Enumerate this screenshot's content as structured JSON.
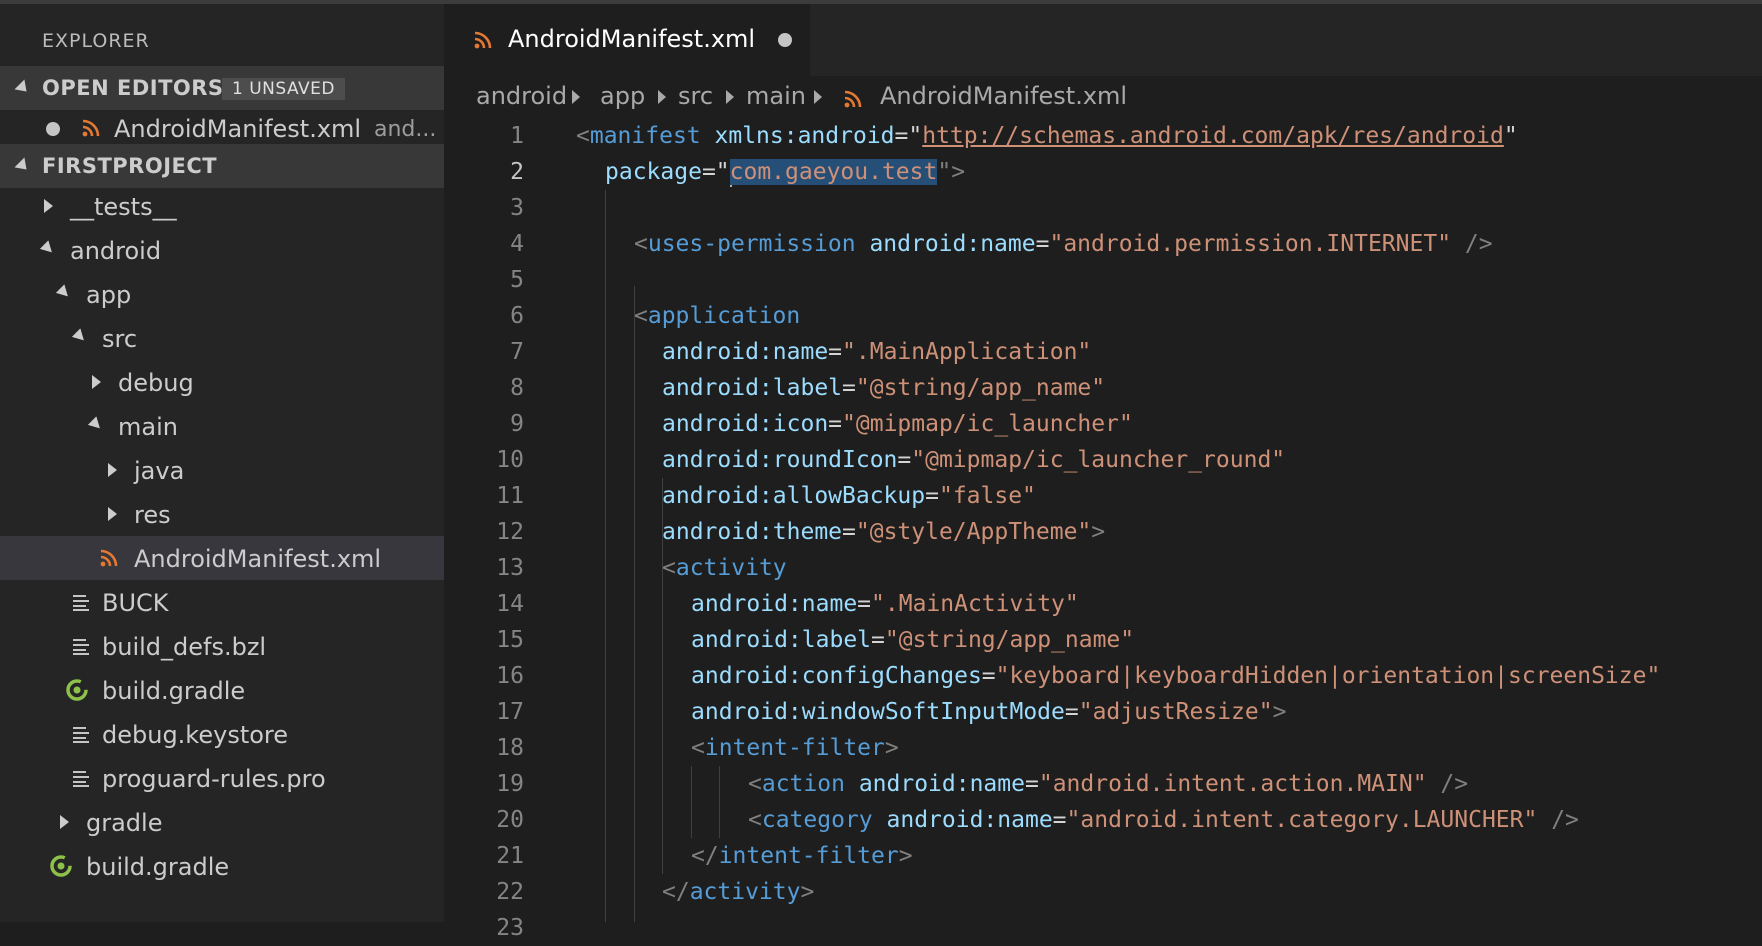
{
  "sidebar": {
    "title": "EXPLORER",
    "open_editors": {
      "label": "OPEN EDITORS",
      "badge": "1 UNSAVED",
      "item": {
        "name": "AndroidManifest.xml",
        "description": "and..."
      }
    },
    "project": {
      "label": "FIRSTPROJECT",
      "tree": [
        {
          "name": "__tests__",
          "kind": "folder-collapsed"
        },
        {
          "name": "android",
          "kind": "folder-expanded"
        },
        {
          "name": "app",
          "kind": "folder-expanded"
        },
        {
          "name": "src",
          "kind": "folder-expanded"
        },
        {
          "name": "debug",
          "kind": "folder-collapsed"
        },
        {
          "name": "main",
          "kind": "folder-expanded"
        },
        {
          "name": "java",
          "kind": "folder-collapsed"
        },
        {
          "name": "res",
          "kind": "folder-collapsed"
        },
        {
          "name": "AndroidManifest.xml",
          "kind": "file-xml",
          "selected": true
        },
        {
          "name": "BUCK",
          "kind": "file-text"
        },
        {
          "name": "build_defs.bzl",
          "kind": "file-text"
        },
        {
          "name": "build.gradle",
          "kind": "file-gradle"
        },
        {
          "name": "debug.keystore",
          "kind": "file-text"
        },
        {
          "name": "proguard-rules.pro",
          "kind": "file-text"
        },
        {
          "name": "gradle",
          "kind": "folder-collapsed"
        },
        {
          "name": "build.gradle",
          "kind": "file-gradle"
        }
      ]
    }
  },
  "editor": {
    "tab": {
      "label": "AndroidManifest.xml",
      "unsaved": true,
      "icon": "rss-icon"
    },
    "breadcrumb": [
      "android",
      "app",
      "src",
      "main",
      "AndroidManifest.xml"
    ],
    "active_line": 2,
    "line_numbers": [
      "1",
      "2",
      "3",
      "4",
      "5",
      "6",
      "7",
      "8",
      "9",
      "10",
      "11",
      "12",
      "13",
      "14",
      "15",
      "16",
      "17",
      "18",
      "19",
      "20",
      "21",
      "22",
      "23"
    ]
  },
  "code": {
    "l1": {
      "open": "<",
      "tag": "manifest",
      "attr": "xmlns:android",
      "eq": "=\"",
      "val": "http://schemas.android.com/apk/res/android",
      "close": "\""
    },
    "l2": {
      "attr": "package",
      "eq": "=\"",
      "val": "com.gaeyou.test",
      "close": "\">"
    },
    "l4": {
      "open": "<",
      "tag": "uses-permission",
      "attr": "android:name",
      "eq": "=",
      "val": "\"android.permission.INTERNET\"",
      "close": " />"
    },
    "l6": {
      "open": "<",
      "tag": "application"
    },
    "l7": {
      "attr": "android:name",
      "eq": "=",
      "val": "\".MainApplication\""
    },
    "l8": {
      "attr": "android:label",
      "eq": "=",
      "val": "\"@string/app_name\""
    },
    "l9": {
      "attr": "android:icon",
      "eq": "=",
      "val": "\"@mipmap/ic_launcher\""
    },
    "l10": {
      "attr": "android:roundIcon",
      "eq": "=",
      "val": "\"@mipmap/ic_launcher_round\""
    },
    "l11": {
      "attr": "android:allowBackup",
      "eq": "=",
      "val": "\"false\""
    },
    "l12": {
      "attr": "android:theme",
      "eq": "=",
      "val": "\"@style/AppTheme\"",
      "close": ">"
    },
    "l13": {
      "open": "<",
      "tag": "activity"
    },
    "l14": {
      "attr": "android:name",
      "eq": "=",
      "val": "\".MainActivity\""
    },
    "l15": {
      "attr": "android:label",
      "eq": "=",
      "val": "\"@string/app_name\""
    },
    "l16": {
      "attr": "android:configChanges",
      "eq": "=",
      "val": "\"keyboard|keyboardHidden|orientation|screenSize\""
    },
    "l17": {
      "attr": "android:windowSoftInputMode",
      "eq": "=",
      "val": "\"adjustResize\"",
      "close": ">"
    },
    "l18": {
      "open": "<",
      "tag": "intent-filter",
      "close": ">"
    },
    "l19": {
      "open": "<",
      "tag": "action",
      "attr": "android:name",
      "eq": "=",
      "val": "\"android.intent.action.MAIN\"",
      "close": " />"
    },
    "l20": {
      "open": "<",
      "tag": "category",
      "attr": "android:name",
      "eq": "=",
      "val": "\"android.intent.category.LAUNCHER\"",
      "close": " />"
    },
    "l21": {
      "open": "</",
      "tag": "intent-filter",
      "close": ">"
    },
    "l22": {
      "open": "</",
      "tag": "activity",
      "close": ">"
    }
  },
  "colors": {
    "sidebar_bg": "#252526",
    "editor_bg": "#1e1e1e",
    "tag": "#569cd6",
    "attribute": "#9cdcfe",
    "string": "#ce9178",
    "selection": "#264f78",
    "xml_icon": "#e37933",
    "gradle_icon": "#8dc149"
  }
}
